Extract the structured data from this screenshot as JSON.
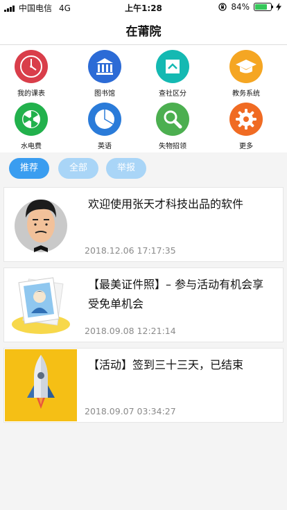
{
  "status_bar": {
    "carrier": "中国电信",
    "network": "4G",
    "time": "上午1:28",
    "battery_percent": "84%",
    "battery_level": 0.84,
    "battery_color": "#35c759"
  },
  "nav": {
    "title": "在莆院"
  },
  "grid": [
    {
      "label": "我的课表",
      "icon": "clock-icon",
      "color": "#d93e4a"
    },
    {
      "label": "图书馆",
      "icon": "library-icon",
      "color": "#2c6bd6"
    },
    {
      "label": "查社区分",
      "icon": "home-icon",
      "color": "#14b9b2"
    },
    {
      "label": "教务系统",
      "icon": "graduation-cap-icon",
      "color": "#f5a623"
    },
    {
      "label": "水电费",
      "icon": "utility-fan-icon",
      "color": "#22b14c"
    },
    {
      "label": "英语",
      "icon": "pie-chart-icon",
      "color": "#2a7bd9"
    },
    {
      "label": "失物招领",
      "icon": "magnifier-icon",
      "color": "#4caf50"
    },
    {
      "label": "更多",
      "icon": "gear-icon",
      "color": "#f06b23"
    }
  ],
  "tabs": [
    {
      "label": "推荐",
      "color": "#3a9df0"
    },
    {
      "label": "全部",
      "color": "#a9d5f7"
    },
    {
      "label": "举报",
      "color": "#a9d5f7"
    }
  ],
  "posts": [
    {
      "title": "欢迎使用张天才科技出品的软件",
      "time": "2018.12.06 17:17:35",
      "thumb": "avatar-man-thumbnail"
    },
    {
      "title": "【最美证件照】– 参与活动有机会享受免单机会",
      "time": "2018.09.08 12:21:14",
      "thumb": "id-photo-thumbnail"
    },
    {
      "title": "【活动】签到三十三天，已结束",
      "time": "2018.09.07 03:34:27",
      "thumb": "rocket-thumbnail"
    }
  ]
}
